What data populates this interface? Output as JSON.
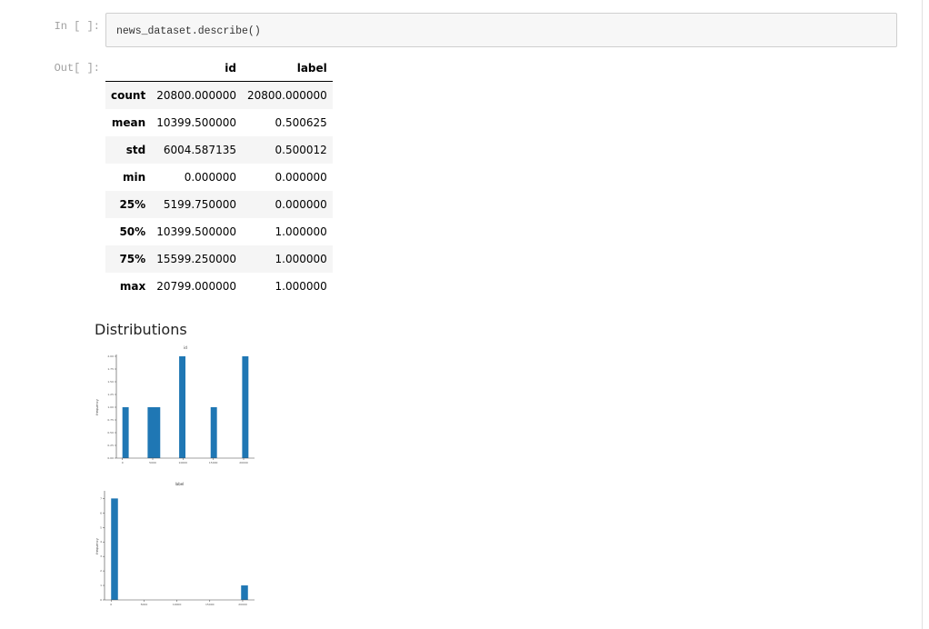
{
  "cells": {
    "input_prompt": "In [ ]:",
    "output_prompt": "Out[ ]:",
    "code": "news_dataset.describe()"
  },
  "describe_table": {
    "columns": [
      "id",
      "label"
    ],
    "rows": [
      {
        "stat": "count",
        "id": "20800.000000",
        "label": "20800.000000"
      },
      {
        "stat": "mean",
        "id": "10399.500000",
        "label": "0.500625"
      },
      {
        "stat": "std",
        "id": "6004.587135",
        "label": "0.500012"
      },
      {
        "stat": "min",
        "id": "0.000000",
        "label": "0.000000"
      },
      {
        "stat": "25%",
        "id": "5199.750000",
        "label": "0.000000"
      },
      {
        "stat": "50%",
        "id": "10399.500000",
        "label": "1.000000"
      },
      {
        "stat": "75%",
        "id": "15599.250000",
        "label": "1.000000"
      },
      {
        "stat": "max",
        "id": "20799.000000",
        "label": "1.000000"
      }
    ]
  },
  "section": {
    "title": "Distributions"
  },
  "colors": {
    "bar": "#1f77b4",
    "stripe": "#f5f5f5"
  },
  "chart_data": [
    {
      "type": "bar",
      "title": "id",
      "ylabel": "frequency",
      "xlabel": "",
      "xlim": [
        -1000,
        21800
      ],
      "ylim": [
        0,
        2.0
      ],
      "xticks": [
        "0",
        "5000",
        "10000",
        "15000",
        "20000"
      ],
      "xtick_values": [
        0,
        5000,
        10000,
        15000,
        20000
      ],
      "yticks": [
        "0.00",
        "0.25",
        "0.50",
        "0.75",
        "1.00",
        "1.25",
        "1.50",
        "1.75",
        "2.00"
      ],
      "ytick_values": [
        0,
        0.25,
        0.5,
        0.75,
        1.0,
        1.25,
        1.5,
        1.75,
        2.0
      ],
      "bins": [
        {
          "x0": 0,
          "x1": 1040,
          "value": 1
        },
        {
          "x0": 4160,
          "x1": 6240,
          "value": 1
        },
        {
          "x0": 9360,
          "x1": 10400,
          "value": 2
        },
        {
          "x0": 14560,
          "x1": 15600,
          "value": 1
        },
        {
          "x0": 19760,
          "x1": 20800,
          "value": 2
        }
      ]
    },
    {
      "type": "bar",
      "title": "label",
      "ylabel": "frequency",
      "xlabel": "",
      "xlim": [
        -1000,
        21800
      ],
      "ylim": [
        0,
        7.4
      ],
      "xticks": [
        "0",
        "5000",
        "10000",
        "15000",
        "20000"
      ],
      "xtick_values": [
        0,
        5000,
        10000,
        15000,
        20000
      ],
      "yticks": [
        "0",
        "1",
        "2",
        "3",
        "4",
        "5",
        "6",
        "7"
      ],
      "ytick_values": [
        0,
        1,
        2,
        3,
        4,
        5,
        6,
        7
      ],
      "bins": [
        {
          "x0": 0,
          "x1": 1040,
          "value": 7
        },
        {
          "x0": 19760,
          "x1": 20800,
          "value": 1
        }
      ]
    }
  ]
}
